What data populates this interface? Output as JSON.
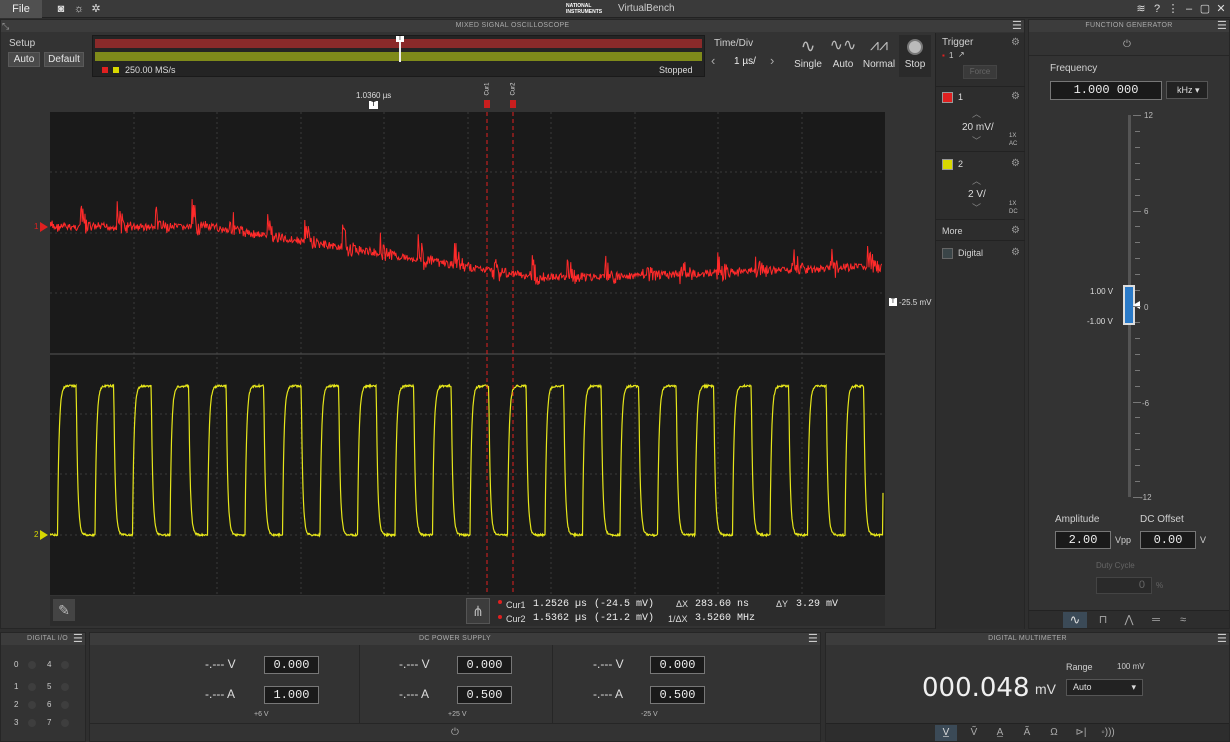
{
  "titlebar": {
    "file_label": "File",
    "brand": "NATIONAL INSTRUMENTS",
    "app_title": "VirtualBench",
    "help": "?"
  },
  "osc": {
    "title": "MIXED SIGNAL OSCILLOSCOPE",
    "setup_label": "Setup",
    "auto_label": "Auto",
    "default_label": "Default",
    "sample_rate": "250.00 MS/s",
    "status": "Stopped",
    "timediv_label": "Time/Div",
    "timediv_value": "1 µs/",
    "modes": [
      "Single",
      "Auto",
      "Normal",
      "Stop"
    ],
    "trigger_time": "1.0360 µs",
    "cursor1_tag": "Cur1",
    "cursor2_tag": "Cur2",
    "trigger_level": "-25.5 mV",
    "ch1_marker": "1",
    "ch2_marker": "2",
    "cursors": {
      "cur1_label": "Cur1",
      "cur1_time": "1.2526 µs",
      "cur1_value": "(-24.5 mV)",
      "cur2_label": "Cur2",
      "cur2_time": "1.5362 µs",
      "cur2_value": "(-21.2 mV)",
      "dx_label": "ΔX",
      "dx_value": "283.60 ns",
      "inv_dx_label": "1/ΔX",
      "inv_dx_value": "3.5260 MHz",
      "dy_label": "ΔY",
      "dy_value": "3.29 mV"
    }
  },
  "side": {
    "trigger_label": "Trigger",
    "trigger_source": "1",
    "force_label": "Force",
    "ch1": {
      "number": "1",
      "scale": "20 mV/",
      "probe": "1X",
      "coupling": "AC",
      "color": "#e02020"
    },
    "ch2": {
      "number": "2",
      "scale": "2 V/",
      "probe": "1X",
      "coupling": "DC",
      "color": "#d8d800"
    },
    "more_label": "More",
    "digital_label": "Digital"
  },
  "fgen": {
    "title": "FUNCTION GENERATOR",
    "frequency_label": "Frequency",
    "frequency_value": "1.000 000",
    "frequency_unit": "kHz",
    "scale_labels": [
      "12",
      "6",
      "0",
      "-6",
      "-12"
    ],
    "high_label": "1.00 V",
    "low_label": "-1.00 V",
    "amplitude_label": "Amplitude",
    "amplitude_value": "2.00",
    "amplitude_unit": "Vpp",
    "offset_label": "DC Offset",
    "offset_value": "0.00",
    "offset_unit": "V",
    "duty_label": "Duty Cycle",
    "duty_value": "0",
    "duty_unit": "%"
  },
  "dio": {
    "title": "DIGITAL I/O",
    "pins": [
      "0",
      "4",
      "1",
      "5",
      "2",
      "6",
      "3",
      "7"
    ]
  },
  "psu": {
    "title": "DC POWER SUPPLY",
    "channels": [
      {
        "v_read": "-.--- V",
        "v_set": "0.000",
        "a_read": "-.--- A",
        "a_set": "1.000",
        "name": "+6 V"
      },
      {
        "v_read": "-.--- V",
        "v_set": "0.000",
        "a_read": "-.--- A",
        "a_set": "0.500",
        "name": "+25 V"
      },
      {
        "v_read": "-.--- V",
        "v_set": "0.000",
        "a_read": "-.--- A",
        "a_set": "0.500",
        "name": "-25 V"
      }
    ]
  },
  "dmm": {
    "title": "DIGITAL MULTIMETER",
    "reading": "000.048",
    "unit": "mV",
    "range_label": "Range",
    "range_value": "100 mV",
    "range_select": "Auto"
  }
}
